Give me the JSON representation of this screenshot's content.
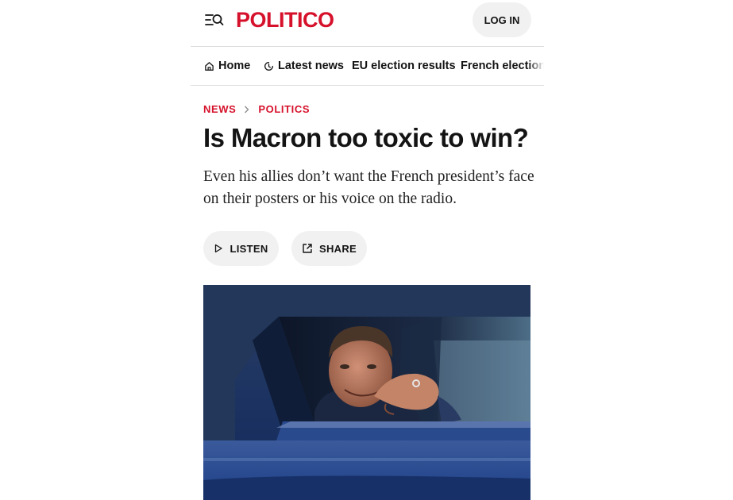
{
  "header": {
    "logo_text": "POLITICO",
    "menu_icon": "menu-search-icon",
    "login_label": "LOG IN",
    "brand_color": "#d6112b"
  },
  "nav": {
    "items": [
      {
        "label": "Home",
        "icon": "home-icon"
      },
      {
        "label": "Latest news",
        "icon": "clock-icon"
      },
      {
        "label": "EU election results"
      },
      {
        "label": "French election"
      }
    ]
  },
  "article": {
    "breadcrumb": [
      "NEWS",
      "POLITICS"
    ],
    "headline": "Is Macron too toxic to win?",
    "dek": "Even his allies don’t want the French president’s face on their posters or his voice on the radio.",
    "actions": {
      "listen_label": "LISTEN",
      "listen_icon": "play-icon",
      "share_label": "SHARE",
      "share_icon": "share-icon"
    }
  }
}
